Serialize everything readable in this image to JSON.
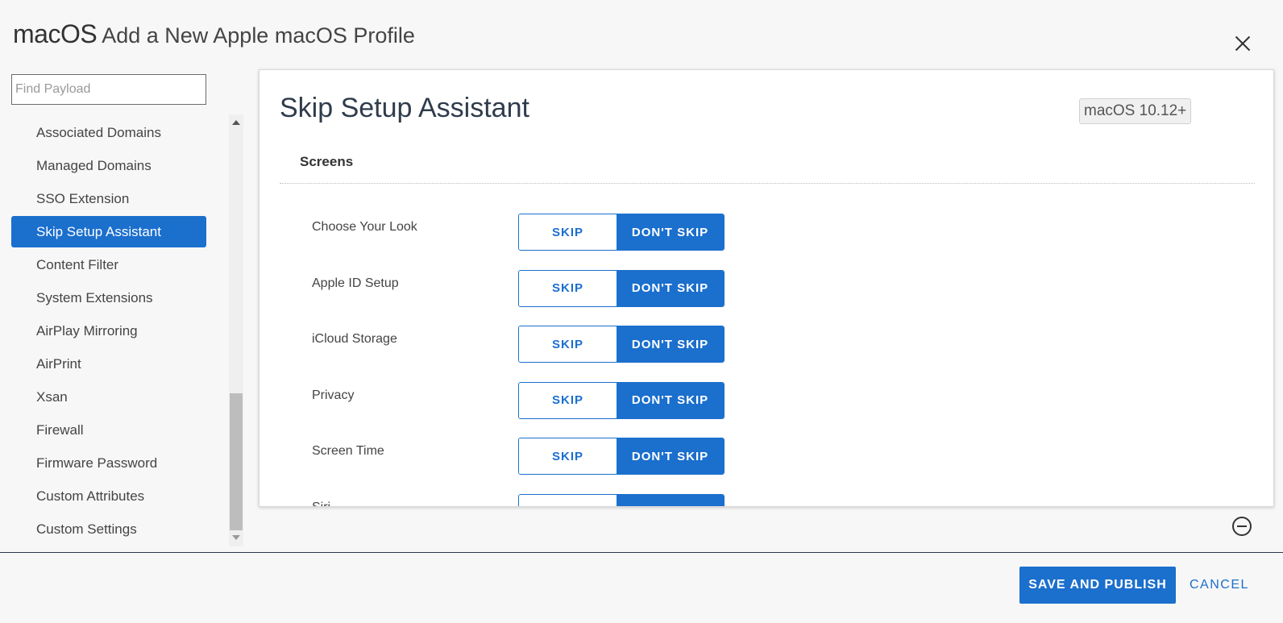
{
  "header": {
    "os": "macOS",
    "title": "Add a New Apple macOS Profile"
  },
  "search": {
    "placeholder": "Find Payload",
    "value": ""
  },
  "sidebar": {
    "items": [
      {
        "label": "Associated Domains",
        "active": false
      },
      {
        "label": "Managed Domains",
        "active": false
      },
      {
        "label": "SSO Extension",
        "active": false
      },
      {
        "label": "Skip Setup Assistant",
        "active": true
      },
      {
        "label": "Content Filter",
        "active": false
      },
      {
        "label": "System Extensions",
        "active": false
      },
      {
        "label": "AirPlay Mirroring",
        "active": false
      },
      {
        "label": "AirPrint",
        "active": false
      },
      {
        "label": "Xsan",
        "active": false
      },
      {
        "label": "Firewall",
        "active": false
      },
      {
        "label": "Firmware Password",
        "active": false
      },
      {
        "label": "Custom Attributes",
        "active": false
      },
      {
        "label": "Custom Settings",
        "active": false
      }
    ]
  },
  "panel": {
    "title": "Skip Setup Assistant",
    "badge": "macOS 10.12+",
    "section": "Screens",
    "skip_label": "SKIP",
    "dont_skip_label": "DON'T SKIP",
    "rows": [
      {
        "label": "Choose Your Look",
        "selected": "DON'T SKIP"
      },
      {
        "label": "Apple ID Setup",
        "selected": "DON'T SKIP"
      },
      {
        "label": "iCloud Storage",
        "selected": "DON'T SKIP"
      },
      {
        "label": "Privacy",
        "selected": "DON'T SKIP"
      },
      {
        "label": "Screen Time",
        "selected": "DON'T SKIP"
      },
      {
        "label": "Siri",
        "selected": "DON'T SKIP"
      }
    ]
  },
  "footer": {
    "save_label": "SAVE AND PUBLISH",
    "cancel_label": "CANCEL"
  },
  "colors": {
    "accent": "#1b6fcd"
  },
  "icons": {
    "close": "close-icon",
    "remove": "remove-circle-icon"
  }
}
